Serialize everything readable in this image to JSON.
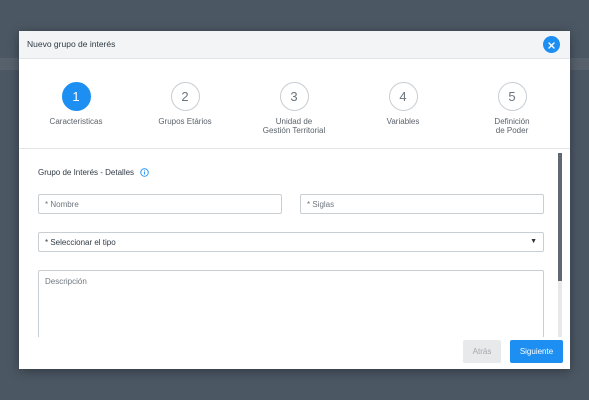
{
  "modal": {
    "title": "Nuevo grupo de interés",
    "accent_color": "#1e8ff2"
  },
  "stepper": {
    "steps": [
      {
        "number": "1",
        "label": "Caracteristicas",
        "active": true
      },
      {
        "number": "2",
        "label": "Grupos Etários",
        "active": false
      },
      {
        "number": "3",
        "label": "Unidad de Gestión Territorial",
        "active": false
      },
      {
        "number": "4",
        "label": "Variables",
        "active": false
      },
      {
        "number": "5",
        "label": "Definición de Poder",
        "active": false
      }
    ]
  },
  "form": {
    "section_title": "Grupo de Interés - Detalles",
    "nombre_placeholder": "* Nombre",
    "siglas_placeholder": "* Siglas",
    "tipo_selected": "* Seleccionar el tipo",
    "descripcion_placeholder": "Descripción"
  },
  "footer": {
    "back_label": "Atrás",
    "next_label": "Siguiente"
  },
  "icons": {
    "close": "close-icon",
    "info": "info-icon",
    "dropdown": "caret-down-icon"
  }
}
